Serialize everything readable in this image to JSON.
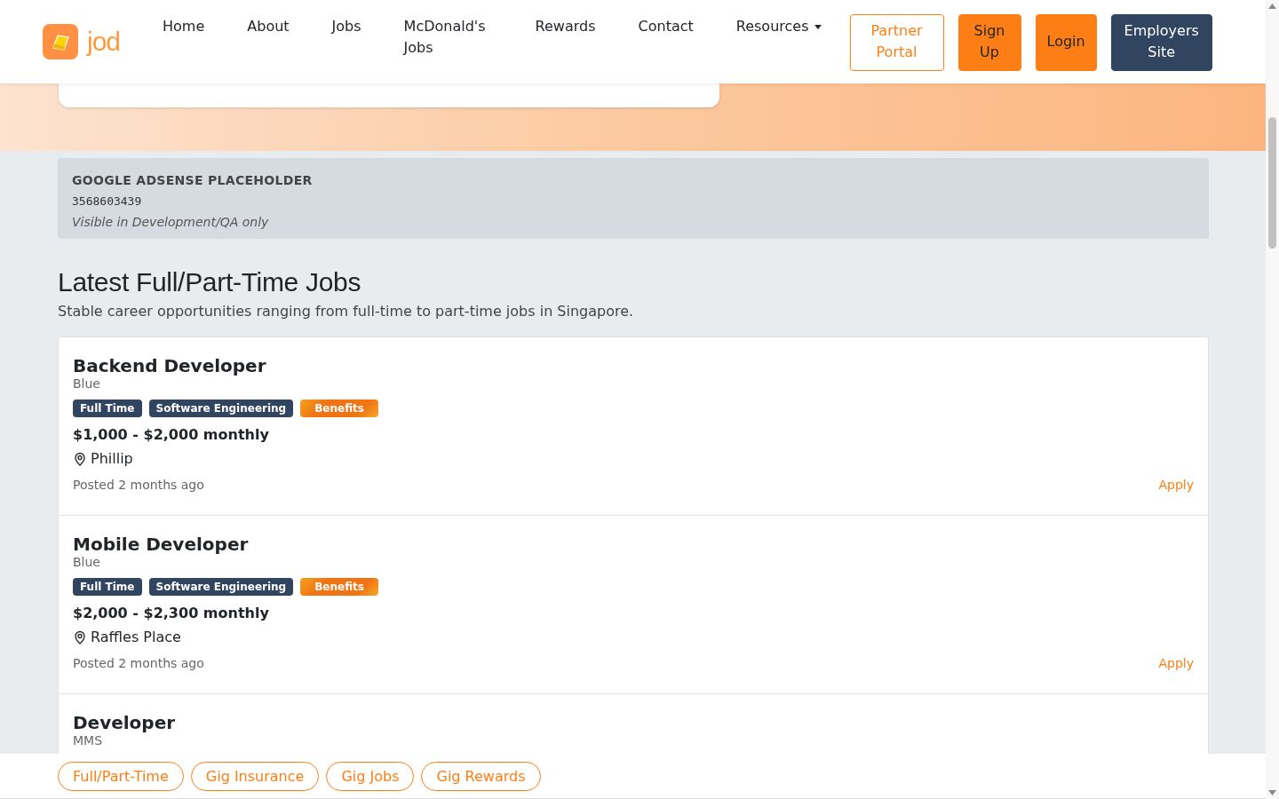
{
  "header": {
    "logo": "jod",
    "nav": [
      {
        "label": "Home",
        "kind": "link"
      },
      {
        "label": "About",
        "kind": "link"
      },
      {
        "label": "Jobs",
        "kind": "link"
      },
      {
        "label": "McDonald's Jobs",
        "kind": "link"
      },
      {
        "label": "Rewards",
        "kind": "link"
      },
      {
        "label": "Contact",
        "kind": "link"
      },
      {
        "label": "Resources",
        "kind": "dropdown"
      }
    ],
    "buttons": [
      {
        "label": "Partner Portal",
        "kind": "outline"
      },
      {
        "label": "Sign Up",
        "kind": "orange"
      },
      {
        "label": "Login",
        "kind": "orange"
      },
      {
        "label": "Employers Site",
        "kind": "dark"
      }
    ]
  },
  "ad": {
    "title": "GOOGLE ADSENSE PLACEHOLDER",
    "code": "3568603439",
    "note": "Visible in Development/QA only"
  },
  "section": {
    "title": "Latest Full/Part-Time Jobs",
    "subtitle": "Stable career opportunities ranging from full-time to part-time jobs in Singapore."
  },
  "jobs": [
    {
      "title": "Backend Developer",
      "company": "Blue",
      "tags": [
        {
          "label": "Full Time",
          "kind": "category"
        },
        {
          "label": "Software Engineering",
          "kind": "category"
        },
        {
          "label": "Benefits",
          "kind": "benefit"
        }
      ],
      "salary": "$1,000 - $2,000 monthly",
      "location": "Phillip",
      "posted": "Posted 2 months ago",
      "action": "Apply"
    },
    {
      "title": "Mobile Developer",
      "company": "Blue",
      "tags": [
        {
          "label": "Full Time",
          "kind": "category"
        },
        {
          "label": "Software Engineering",
          "kind": "category"
        },
        {
          "label": "Benefits",
          "kind": "benefit"
        }
      ],
      "salary": "$2,000 - $2,300 monthly",
      "location": "Raffles Place",
      "posted": "Posted 2 months ago",
      "action": "Apply"
    },
    {
      "title": "Developer",
      "company": "MMS"
    }
  ],
  "bottom_tabs": [
    "Full/Part-Time",
    "Gig Insurance",
    "Gig Jobs",
    "Gig Rewards"
  ]
}
